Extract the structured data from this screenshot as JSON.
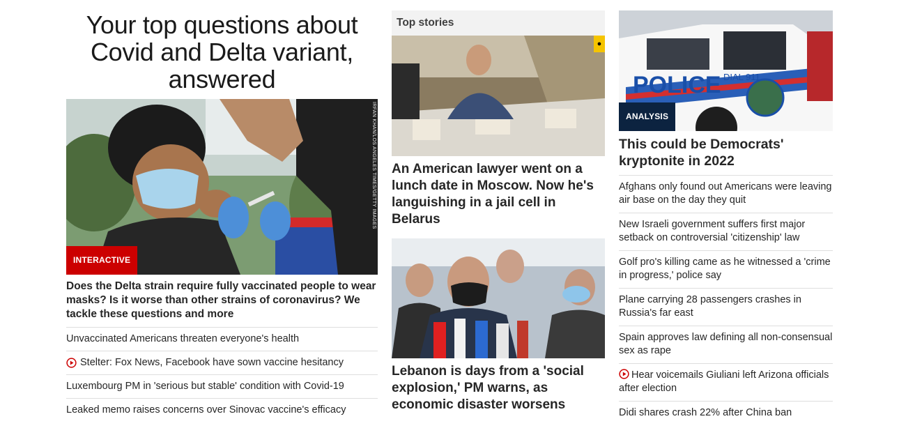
{
  "left": {
    "title": "Your top questions about Covid and Delta variant, answered",
    "image_credit": "IRFAN KHAN/LOS ANGELES TIMES/GETTY IMAGES",
    "badge": "INTERACTIVE",
    "headline": "Does the Delta strain require fully vaccinated people to wear masks? Is it worse than other strains of coronavirus? We tackle these questions and more",
    "items": [
      {
        "text": "Unvaccinated Americans threaten everyone's health",
        "video": false
      },
      {
        "text": "Stelter: Fox News, Facebook have sown vaccine hesitancy",
        "video": true
      },
      {
        "text": "Luxembourg PM in 'serious but stable' condition with Covid-19",
        "video": false
      },
      {
        "text": "Leaked memo raises concerns over Sinovac vaccine's efficacy",
        "video": false
      }
    ]
  },
  "middle": {
    "section_label": "Top stories",
    "story1": "An American lawyer went on a lunch date in Moscow. Now he's languishing in a jail cell in Belarus",
    "story2": "Lebanon is days from a 'social explosion,' PM warns, as economic disaster worsens"
  },
  "right": {
    "badge": "ANALYSIS",
    "headline": "This could be Democrats' kryptonite in 2022",
    "items": [
      {
        "text": "Afghans only found out Americans were leaving air base on the day they quit",
        "video": false
      },
      {
        "text": "New Israeli government suffers first major setback on controversial 'citizenship' law",
        "video": false
      },
      {
        "text": "Golf pro's killing came as he witnessed a 'crime in progress,' police say",
        "video": false
      },
      {
        "text": "Plane carrying 28 passengers crashes in Russia's far east",
        "video": false
      },
      {
        "text": "Spain approves law defining all non-consensual sex as rape",
        "video": false
      },
      {
        "text": "Hear voicemails Giuliani left Arizona officials after election",
        "video": true
      },
      {
        "text": "Didi shares crash 22% after China ban",
        "video": false
      }
    ]
  },
  "colors": {
    "interactive_badge": "#cc0000",
    "analysis_badge": "#0c2340",
    "video_icon": "#cc0000",
    "divider": "#dedede"
  },
  "icons": {
    "video": "play-circle-icon"
  }
}
